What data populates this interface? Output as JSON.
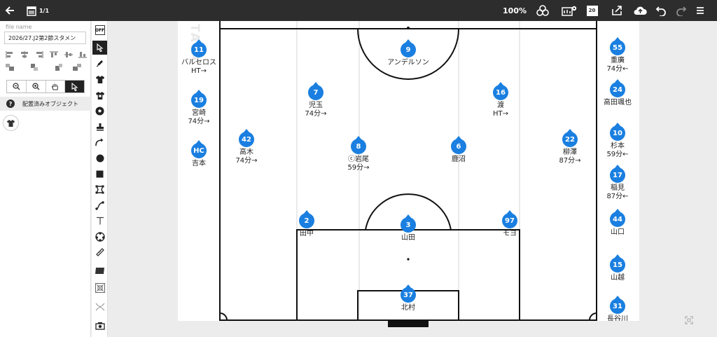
{
  "topbar": {
    "page_counter": "1/1",
    "zoom": "100%",
    "number_badge": "20"
  },
  "leftpanel": {
    "file_name_label": "file name",
    "file_name_value": "2026/27.J2第2節スタメン",
    "placed_objects_label": "配置済みオブジェクト"
  },
  "tools": {
    "toggle_label": "OFF"
  },
  "canvas": {
    "watermark": "ТАСА",
    "starters": [
      {
        "number": "9",
        "name": "アンデルソン",
        "sub": ""
      },
      {
        "number": "7",
        "name": "児玉",
        "sub": "74分→"
      },
      {
        "number": "16",
        "name": "渡",
        "sub": "HT→"
      },
      {
        "number": "42",
        "name": "高木",
        "sub": "74分→"
      },
      {
        "number": "8",
        "name": "ⓒ岩尾",
        "sub": "59分→"
      },
      {
        "number": "6",
        "name": "鹿沼",
        "sub": ""
      },
      {
        "number": "22",
        "name": "柳澤",
        "sub": "87分→"
      },
      {
        "number": "2",
        "name": "田中",
        "sub": ""
      },
      {
        "number": "3",
        "name": "山田",
        "sub": ""
      },
      {
        "number": "97",
        "name": "モヨ",
        "sub": ""
      },
      {
        "number": "37",
        "name": "北村",
        "sub": ""
      }
    ],
    "left_bench": [
      {
        "number": "11",
        "name": "バルセロス",
        "sub": "HT→"
      },
      {
        "number": "19",
        "name": "宮崎",
        "sub": "74分→"
      },
      {
        "number": "HC",
        "name": "吉本",
        "sub": ""
      }
    ],
    "right_bench": [
      {
        "number": "55",
        "name": "重廣",
        "sub": "74分←"
      },
      {
        "number": "24",
        "name": "高田颯也",
        "sub": ""
      },
      {
        "number": "10",
        "name": "杉本",
        "sub": "59分←"
      },
      {
        "number": "17",
        "name": "稲見",
        "sub": "87分←"
      },
      {
        "number": "44",
        "name": "山口",
        "sub": ""
      },
      {
        "number": "15",
        "name": "山越",
        "sub": ""
      },
      {
        "number": "31",
        "name": "長谷川",
        "sub": ""
      }
    ]
  },
  "colors": {
    "topbar": "#2d2d2d",
    "player_marker": "#1a7fe0",
    "pitch_line": "#111111",
    "guide_line": "#d0d0d0"
  },
  "icons": [
    "back-arrow-icon",
    "calendar-icon",
    "shapes-icon",
    "settings-icon",
    "share-icon",
    "cloud-upload-icon",
    "undo-icon",
    "redo-icon",
    "menu-icon"
  ]
}
